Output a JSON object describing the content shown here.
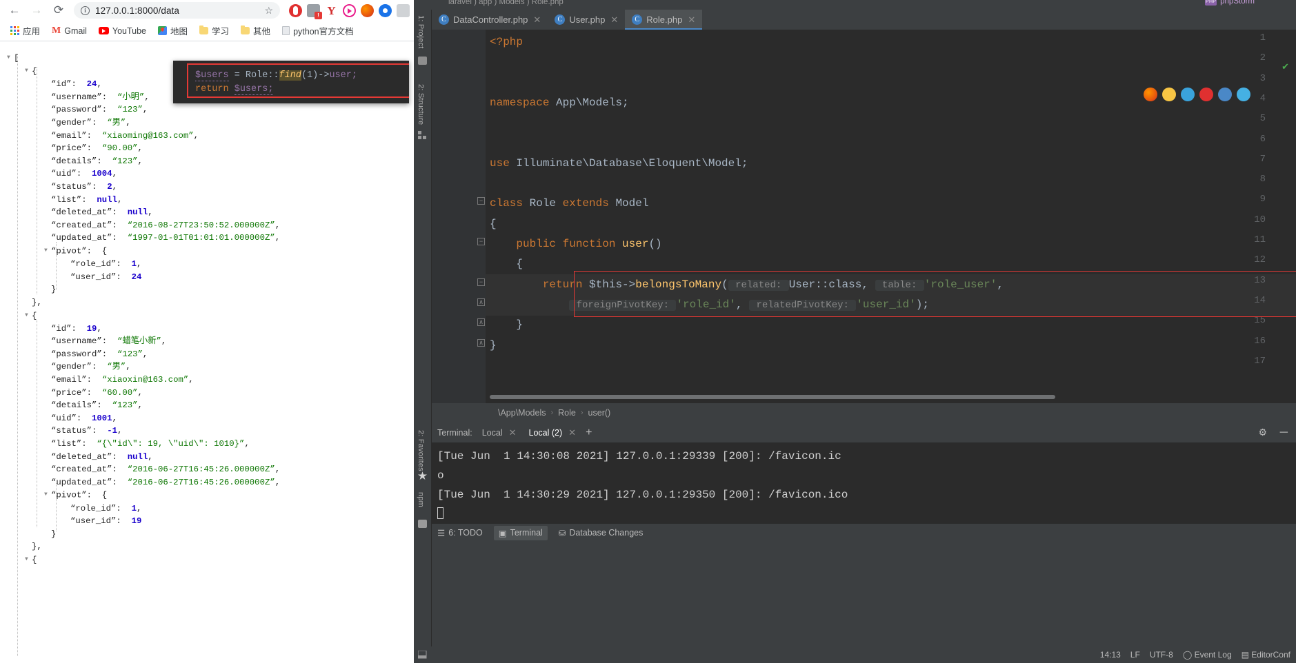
{
  "browser": {
    "nav": {
      "back": "←",
      "forward": "→",
      "reload": "⟳"
    },
    "omnibox": {
      "url": "127.0.0.1:8000/data",
      "info_icon": "info-icon",
      "star_icon": "bookmark-star-icon"
    },
    "extensions": [
      {
        "name": "opera-vpn-icon"
      },
      {
        "name": "extension-warning-icon"
      },
      {
        "name": "yandex-icon",
        "glyph": "Y"
      },
      {
        "name": "pink-circle-extension-icon"
      },
      {
        "name": "firefox-extension-icon"
      },
      {
        "name": "blue-extension-icon"
      },
      {
        "name": "sheets-extension-icon"
      }
    ],
    "bookmarks": [
      {
        "label": "应用",
        "icon": "apps-grid-icon"
      },
      {
        "label": "Gmail",
        "icon": "gmail-icon"
      },
      {
        "label": "YouTube",
        "icon": "youtube-icon"
      },
      {
        "label": "地图",
        "icon": "maps-icon"
      },
      {
        "label": "学习",
        "icon": "folder-icon"
      },
      {
        "label": "其他",
        "icon": "folder-icon"
      },
      {
        "label": "python官方文档",
        "icon": "document-icon"
      }
    ]
  },
  "json_viewer": {
    "root_open": "[",
    "records": [
      {
        "id": 24,
        "username": "小明",
        "password": "123",
        "gender": "男",
        "email": "xiaoming@163.com",
        "price": "90.00",
        "details": "123",
        "uid": 1004,
        "status": 2,
        "list": "null",
        "deleted_at": "null",
        "created_at": "2016-08-27T23:50:52.000000Z",
        "updated_at": "1997-01-01T01:01:01.000000Z",
        "pivot": {
          "role_id": 1,
          "user_id": 24
        }
      },
      {
        "id": 19,
        "username": "蜡笔小新",
        "password": "123",
        "gender": "男",
        "email": "xiaoxin@163.com",
        "price": "60.00",
        "details": "123",
        "uid": 1001,
        "status": -1,
        "list": "{\\\"id\\\": 19, \\\"uid\\\": 1010}",
        "deleted_at": "null",
        "created_at": "2016-06-27T16:45:26.000000Z",
        "updated_at": "2016-06-27T16:45:26.000000Z",
        "pivot": {
          "role_id": 1,
          "user_id": 19
        }
      }
    ],
    "labels": {
      "id": "\"id\":",
      "username": "\"username\":",
      "password": "\"password\":",
      "gender": "\"gender\":",
      "email": "\"email\":",
      "price": "\"price\":",
      "details": "\"details\":",
      "uid": "\"uid\":",
      "status": "\"status\":",
      "list": "\"list\":",
      "deleted_at": "\"deleted_at\":",
      "created_at": "\"created_at\":",
      "updated_at": "\"updated_at\":",
      "pivot": "\"pivot\":",
      "role_id": "\"role_id\":",
      "user_id": "\"user_id\":"
    }
  },
  "code_popup": {
    "line1": {
      "var": "$users",
      "eq": " = ",
      "cls": "Role::",
      "fn": "find",
      "args": "(1)",
      "arrow": "->",
      "prop": "user;"
    },
    "line2": {
      "kw": "return ",
      "var": "$users;"
    }
  },
  "ide": {
    "breadcrumb_top": "laravel ) app ) Models ) Role.php",
    "product": "phpStorm",
    "tabs": [
      {
        "label": "DataController.php",
        "active": false
      },
      {
        "label": "User.php",
        "active": false
      },
      {
        "label": "Role.php",
        "active": true
      }
    ],
    "left_rail": [
      "1: Project",
      "2: Structure",
      "2: Favorites",
      "npm"
    ],
    "line_numbers": [
      "1",
      "2",
      "3",
      "4",
      "5",
      "6",
      "7",
      "8",
      "9",
      "10",
      "11",
      "12",
      "13",
      "14",
      "15",
      "16",
      "17"
    ],
    "code_lines": [
      {
        "n": 1,
        "segs": [
          {
            "t": "<?php",
            "c": "kw"
          }
        ]
      },
      {
        "n": 2,
        "segs": []
      },
      {
        "n": 3,
        "segs": []
      },
      {
        "n": 4,
        "segs": [
          {
            "t": "namespace ",
            "c": "kw"
          },
          {
            "t": "App\\Models;",
            "c": "cls"
          }
        ]
      },
      {
        "n": 5,
        "segs": []
      },
      {
        "n": 6,
        "segs": []
      },
      {
        "n": 7,
        "segs": [
          {
            "t": "use ",
            "c": "kw"
          },
          {
            "t": "Illuminate\\Database\\Eloquent\\Model;",
            "c": "cls"
          }
        ]
      },
      {
        "n": 8,
        "segs": []
      },
      {
        "n": 9,
        "segs": [
          {
            "t": "class ",
            "c": "kw"
          },
          {
            "t": "Role ",
            "c": "cls"
          },
          {
            "t": "extends ",
            "c": "kw"
          },
          {
            "t": "Model",
            "c": "cls"
          }
        ]
      },
      {
        "n": 10,
        "segs": [
          {
            "t": "{",
            "c": "cls"
          }
        ]
      },
      {
        "n": 11,
        "segs": [
          {
            "t": "    public function ",
            "c": "kw"
          },
          {
            "t": "user",
            "c": "fname"
          },
          {
            "t": "()",
            "c": "cls"
          }
        ]
      },
      {
        "n": 12,
        "segs": [
          {
            "t": "    {",
            "c": "cls"
          }
        ]
      },
      {
        "n": 13,
        "segs": [
          {
            "t": "        return ",
            "c": "kw"
          },
          {
            "t": "$this",
            "c": "cls"
          },
          {
            "t": "->",
            "c": "cls"
          },
          {
            "t": "belongsToMany",
            "c": "fname"
          },
          {
            "t": "(",
            "c": "cls"
          },
          {
            "t": " related: ",
            "c": "hint"
          },
          {
            "t": "User::class",
            "c": "cls"
          },
          {
            "t": ", ",
            "c": "cls"
          },
          {
            "t": " table: ",
            "c": "hint"
          },
          {
            "t": "'role_user'",
            "c": "str"
          },
          {
            "t": ",",
            "c": "cls"
          }
        ]
      },
      {
        "n": 14,
        "segs": [
          {
            "t": "            ",
            "c": "cls"
          },
          {
            "t": " foreignPivotKey: ",
            "c": "hint"
          },
          {
            "t": "'role_id'",
            "c": "str"
          },
          {
            "t": ", ",
            "c": "cls"
          },
          {
            "t": " relatedPivotKey: ",
            "c": "hint"
          },
          {
            "t": "'user_id'",
            "c": "str"
          },
          {
            "t": ");",
            "c": "cls"
          }
        ]
      },
      {
        "n": 15,
        "segs": [
          {
            "t": "    }",
            "c": "cls"
          }
        ]
      },
      {
        "n": 16,
        "segs": [
          {
            "t": "}",
            "c": "cls"
          }
        ]
      },
      {
        "n": 17,
        "segs": []
      }
    ],
    "breadcrumb": [
      "\\App\\Models",
      "Role",
      "user()"
    ],
    "terminal": {
      "label": "Terminal:",
      "tabs": [
        {
          "label": "Local",
          "active": false
        },
        {
          "label": "Local (2)",
          "active": true
        }
      ],
      "add": "+",
      "settings_icon": "gear-icon",
      "minimize_icon": "minimize-icon",
      "lines": [
        "[Tue Jun  1 14:30:08 2021] 127.0.0.1:29339 [200]: /favicon.ic",
        "o",
        "[Tue Jun  1 14:30:29 2021] 127.0.0.1:29350 [200]: /favicon.ico"
      ]
    },
    "tool_windows": [
      {
        "label": "6: TODO",
        "icon": "list-icon",
        "active": false
      },
      {
        "label": "Terminal",
        "icon": "terminal-icon",
        "active": true
      },
      {
        "label": "Database Changes",
        "icon": "database-icon",
        "active": false
      }
    ],
    "status_bar": {
      "time": "14:13",
      "line_sep": "LF",
      "encoding": "UTF-8",
      "event_log": "Event Log",
      "editor_config": "EditorConf"
    },
    "colors": {
      "accent": "#4a88c7",
      "highlight_red": "#e53935",
      "editor_bg": "#2b2b2b",
      "chrome_bg": "#3c3f41"
    }
  }
}
